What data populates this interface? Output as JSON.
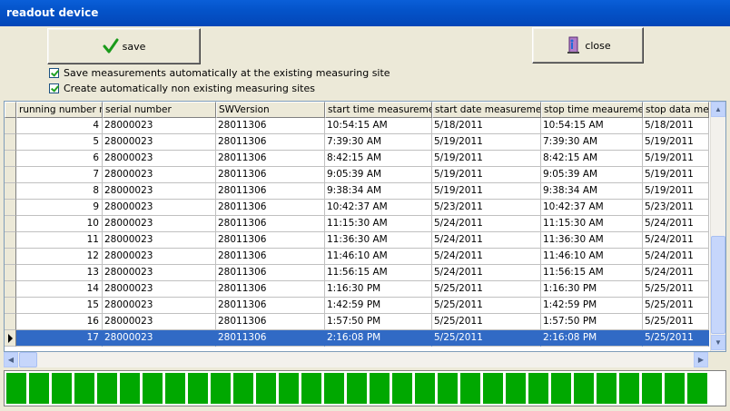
{
  "window": {
    "title": "readout device"
  },
  "toolbar": {
    "save_label": "save",
    "close_label": "close",
    "save_icon": "checkmark-icon",
    "close_icon": "door-exit-icon"
  },
  "options": {
    "auto_save_label": "Save measurements automatically at the existing measuring site",
    "auto_save_checked": true,
    "auto_create_label": "Create automatically non existing measuring sites",
    "auto_create_checked": true
  },
  "table": {
    "columns": [
      "running number me",
      "serial number",
      "SWVersion",
      "start time measurement",
      "start date measurement",
      "stop time meaurement",
      "stop data mea"
    ],
    "rows": [
      [
        "4",
        "28000023",
        "28011306",
        "10:54:15 AM",
        "5/18/2011",
        "10:54:15 AM",
        "5/18/2011"
      ],
      [
        "5",
        "28000023",
        "28011306",
        "7:39:30 AM",
        "5/19/2011",
        "7:39:30 AM",
        "5/19/2011"
      ],
      [
        "6",
        "28000023",
        "28011306",
        "8:42:15 AM",
        "5/19/2011",
        "8:42:15 AM",
        "5/19/2011"
      ],
      [
        "7",
        "28000023",
        "28011306",
        "9:05:39 AM",
        "5/19/2011",
        "9:05:39 AM",
        "5/19/2011"
      ],
      [
        "8",
        "28000023",
        "28011306",
        "9:38:34 AM",
        "5/19/2011",
        "9:38:34 AM",
        "5/19/2011"
      ],
      [
        "9",
        "28000023",
        "28011306",
        "10:42:37 AM",
        "5/23/2011",
        "10:42:37 AM",
        "5/23/2011"
      ],
      [
        "10",
        "28000023",
        "28011306",
        "11:15:30 AM",
        "5/24/2011",
        "11:15:30 AM",
        "5/24/2011"
      ],
      [
        "11",
        "28000023",
        "28011306",
        "11:36:30 AM",
        "5/24/2011",
        "11:36:30 AM",
        "5/24/2011"
      ],
      [
        "12",
        "28000023",
        "28011306",
        "11:46:10 AM",
        "5/24/2011",
        "11:46:10 AM",
        "5/24/2011"
      ],
      [
        "13",
        "28000023",
        "28011306",
        "11:56:15 AM",
        "5/24/2011",
        "11:56:15 AM",
        "5/24/2011"
      ],
      [
        "14",
        "28000023",
        "28011306",
        "1:16:30 PM",
        "5/25/2011",
        "1:16:30 PM",
        "5/25/2011"
      ],
      [
        "15",
        "28000023",
        "28011306",
        "1:42:59 PM",
        "5/25/2011",
        "1:42:59 PM",
        "5/25/2011"
      ],
      [
        "16",
        "28000023",
        "28011306",
        "1:57:50 PM",
        "5/25/2011",
        "1:57:50 PM",
        "5/25/2011"
      ],
      [
        "17",
        "28000023",
        "28011306",
        "2:16:08 PM",
        "5/25/2011",
        "2:16:08 PM",
        "5/25/2011"
      ]
    ],
    "selected_row": 13
  },
  "progress": {
    "fraction": 1.0
  },
  "colors": {
    "title_bar": "#0453c9",
    "selection": "#316ac5",
    "progress": "#00a800"
  }
}
